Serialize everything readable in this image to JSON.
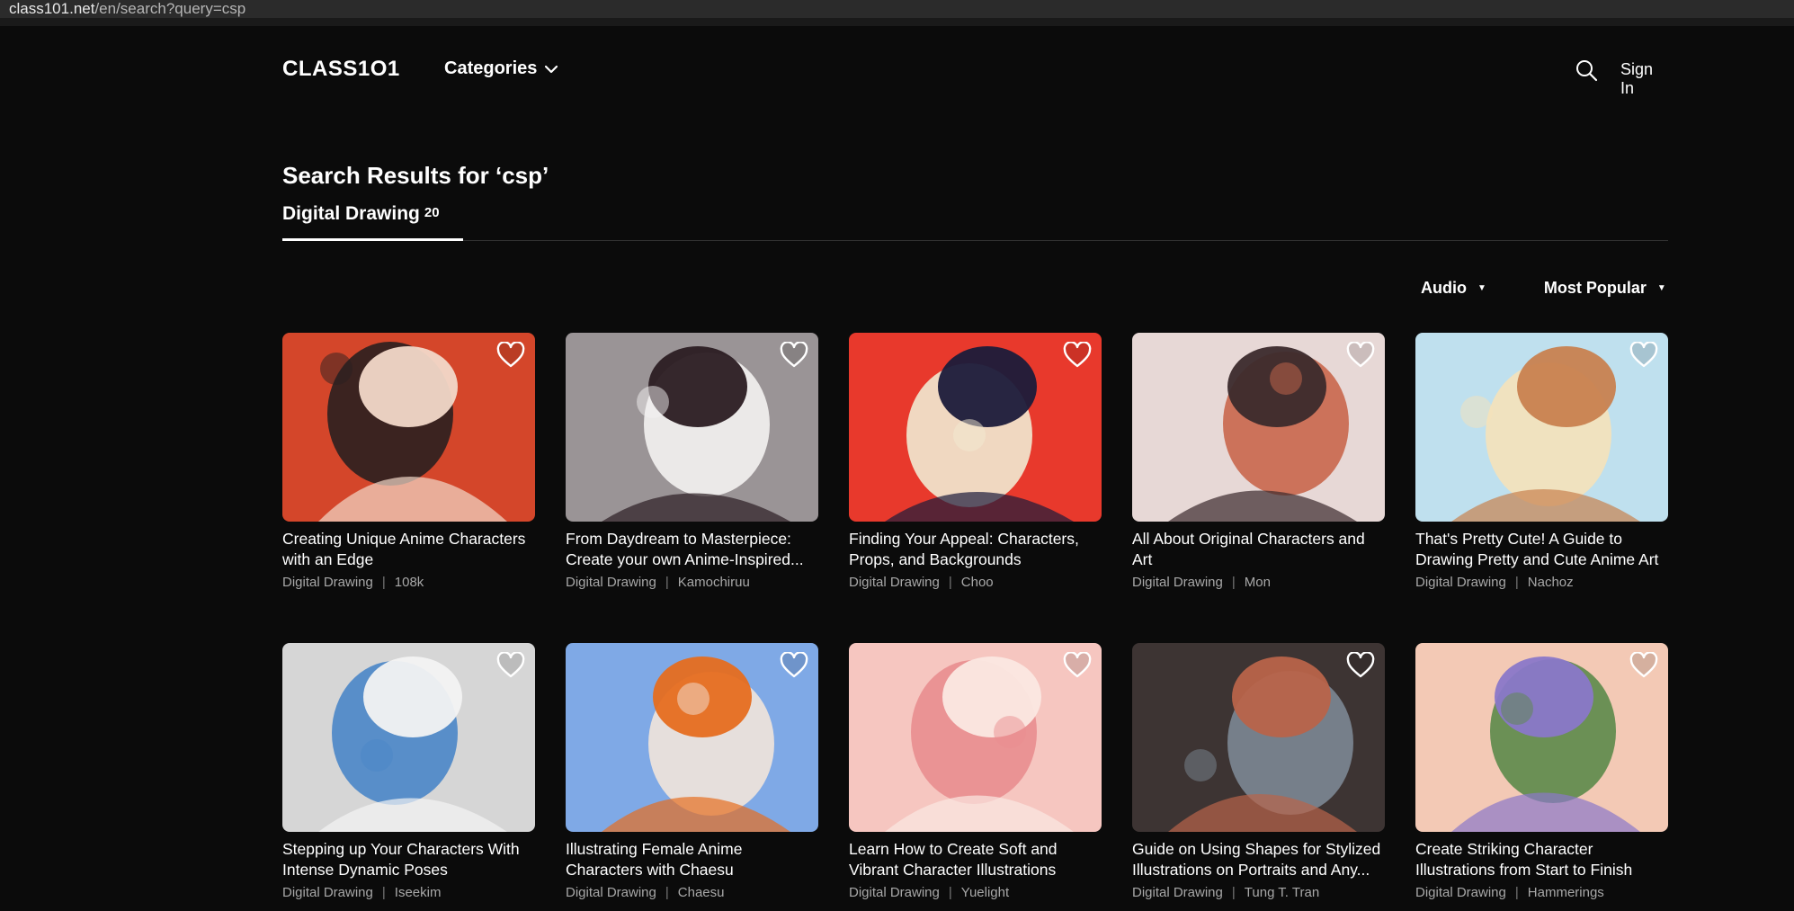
{
  "browser": {
    "url_host": "class101.net",
    "url_path": "/en/search?query=csp"
  },
  "header": {
    "logo": "CLASS1O1",
    "categories_label": "Categories",
    "signin_label": "Sign In"
  },
  "results": {
    "title": "Search Results for ‘csp’"
  },
  "tabs": [
    {
      "label": "Digital Drawing",
      "count": "20"
    }
  ],
  "filters": [
    {
      "label": "Audio"
    },
    {
      "label": "Most Popular"
    }
  ],
  "cards": [
    {
      "title": "Creating Unique Anime Characters with an Edge",
      "category": "Digital Drawing",
      "author": "108k",
      "palette": [
        "#d4462a",
        "#f2d9c9",
        "#2a1f1f"
      ]
    },
    {
      "title": "From Daydream to Masterpiece: Create your own Anime-Inspired...",
      "category": "Digital Drawing",
      "author": "Kamochiruu",
      "palette": [
        "#9a9496",
        "#2b1c22",
        "#f4f2f1"
      ]
    },
    {
      "title": "Finding Your Appeal: Characters, Props, and Backgrounds",
      "category": "Digital Drawing",
      "author": "Choo",
      "palette": [
        "#e8392c",
        "#1b1b3a",
        "#f1ead2"
      ]
    },
    {
      "title": "All About Original Characters and Art",
      "category": "Digital Drawing",
      "author": "Mon",
      "palette": [
        "#e7d8d6",
        "#3b2a2c",
        "#c9674c"
      ]
    },
    {
      "title": "That's Pretty Cute! A Guide to Drawing Pretty and Cute Anime Art",
      "category": "Digital Drawing",
      "author": "Nachoz",
      "palette": [
        "#bfe0ee",
        "#c8814f",
        "#f5e2b9"
      ]
    },
    {
      "title": "Stepping up Your Characters With Intense Dynamic Poses",
      "category": "Digital Drawing",
      "author": "Iseekim",
      "palette": [
        "#d6d6d6",
        "#f3f3f3",
        "#4a86c8"
      ]
    },
    {
      "title": "Illustrating Female Anime Characters with Chaesu",
      "category": "Digital Drawing",
      "author": "Chaesu",
      "palette": [
        "#7fa9e6",
        "#e66d1f",
        "#f2e4da"
      ]
    },
    {
      "title": "Learn How to Create Soft and Vibrant Character Illustrations",
      "category": "Digital Drawing",
      "author": "Yuelight",
      "palette": [
        "#f6c6c0",
        "#fbe8e2",
        "#e98d8f"
      ]
    },
    {
      "title": "Guide on Using Shapes for Stylized Illustrations on Portraits and Any...",
      "category": "Digital Drawing",
      "author": "Tung T. Tran",
      "palette": [
        "#3d3433",
        "#b8644a",
        "#7c8794"
      ]
    },
    {
      "title": "Create Striking Character Illustrations from Start to Finish",
      "category": "Digital Drawing",
      "author": "Hammerings",
      "palette": [
        "#f3c9b5",
        "#8a78c9",
        "#5c8a4a"
      ]
    }
  ]
}
